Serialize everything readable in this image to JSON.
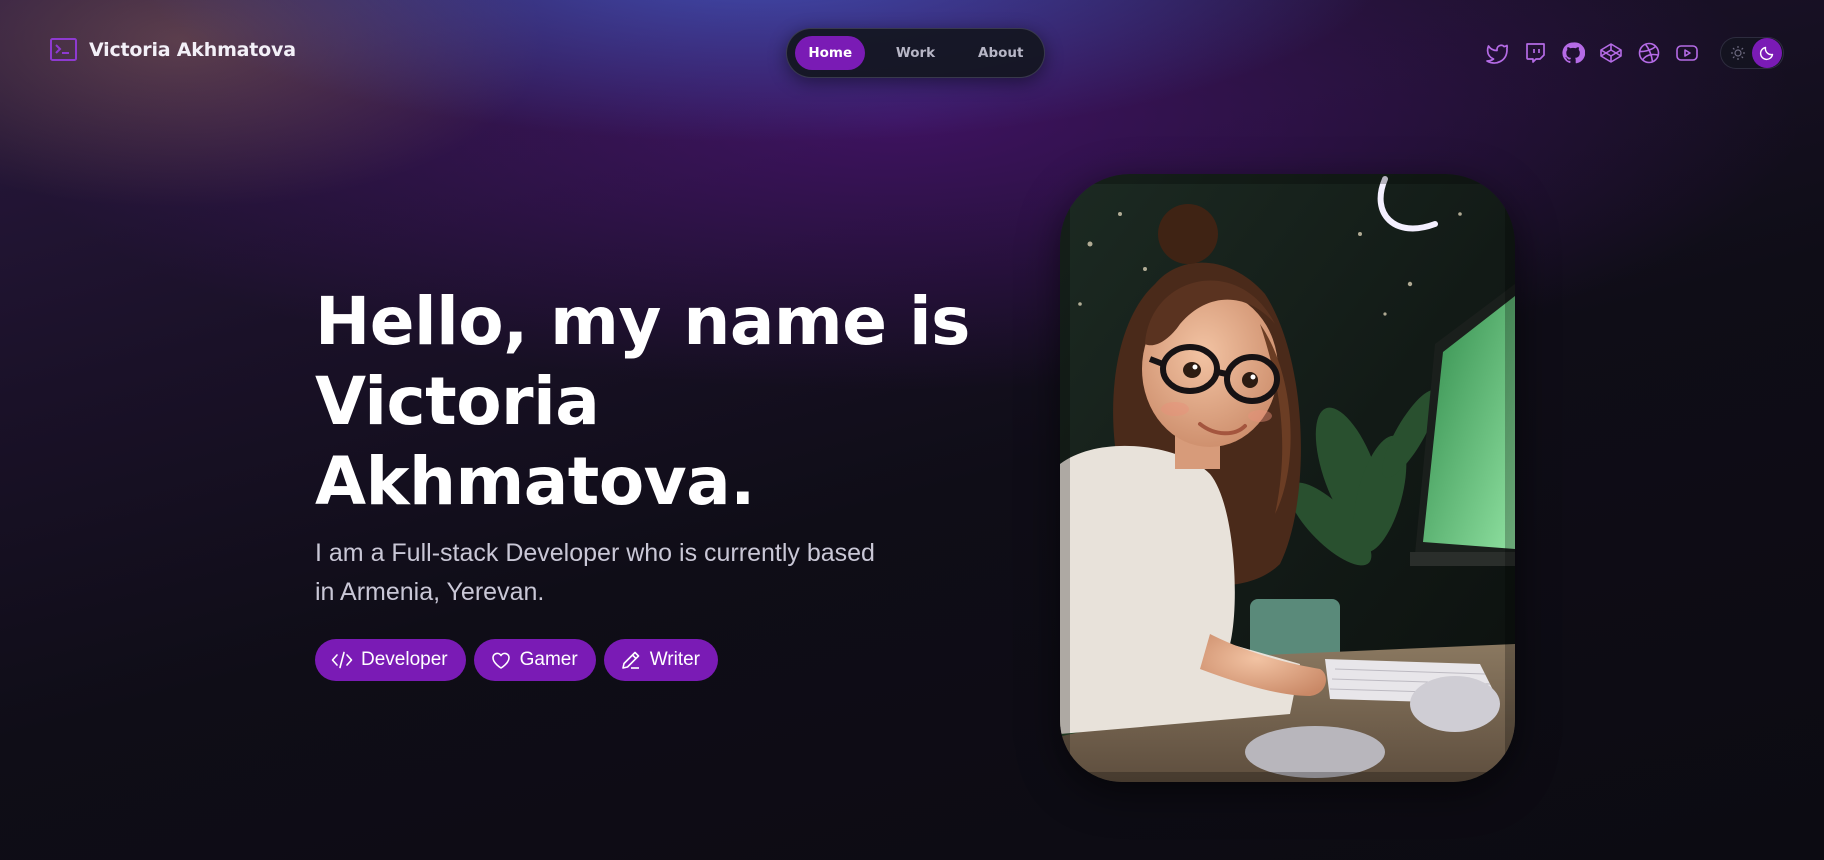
{
  "brand": {
    "name": "Victoria Akhmatova",
    "icon": "terminal-icon"
  },
  "nav": {
    "items": [
      {
        "label": "Home",
        "active": true
      },
      {
        "label": "Work",
        "active": false
      },
      {
        "label": "About",
        "active": false
      }
    ]
  },
  "socials": [
    "twitter-icon",
    "twitch-icon",
    "github-icon",
    "codepen-icon",
    "dribbble-icon",
    "youtube-icon"
  ],
  "theme": {
    "mode": "dark",
    "icons": [
      "sun-icon",
      "moon-icon"
    ]
  },
  "hero": {
    "title_lines": [
      "Hello, my name is",
      "Victoria",
      "Akhmatova."
    ],
    "subtitle": "I am a Full-stack Developer who is currently based in Armenia, Yerevan.",
    "tags": [
      {
        "label": "Developer",
        "icon": "code-icon"
      },
      {
        "label": "Gamer",
        "icon": "heart-icon"
      },
      {
        "label": "Writer",
        "icon": "pencil-icon"
      }
    ]
  },
  "colors": {
    "accent": "#7a1bb5",
    "icon_accent": "#b56be6",
    "background": "#0c0b12"
  }
}
